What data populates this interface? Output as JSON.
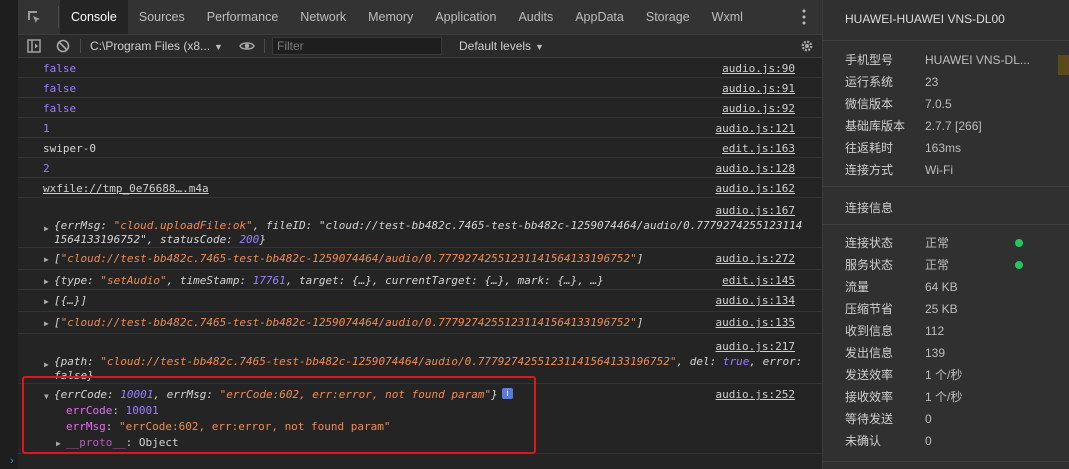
{
  "tabs": [
    {
      "label": "Console",
      "active": true
    },
    {
      "label": "Sources"
    },
    {
      "label": "Performance"
    },
    {
      "label": "Network"
    },
    {
      "label": "Memory"
    },
    {
      "label": "Application"
    },
    {
      "label": "Audits"
    },
    {
      "label": "AppData"
    },
    {
      "label": "Storage"
    },
    {
      "label": "Wxml"
    }
  ],
  "toolbar": {
    "context_label": "C:\\Program Files (x8...",
    "filter_placeholder": "Filter",
    "levels_label": "Default levels",
    "icons": [
      "inspect-icon",
      "sidebar-toggle-icon",
      "clear-console-icon",
      "eye-icon",
      "gear-icon",
      "more-vert-icon"
    ]
  },
  "console": {
    "lines": [
      {
        "text": "false",
        "type": "bool",
        "source": "audio.js:90"
      },
      {
        "text": "false",
        "type": "bool",
        "source": "audio.js:91"
      },
      {
        "text": "false",
        "type": "bool",
        "source": "audio.js:92"
      },
      {
        "text": "1",
        "type": "num",
        "source": "audio.js:121"
      },
      {
        "text": "swiper-0",
        "type": "plain",
        "source": "edit.js:163"
      },
      {
        "text": "2",
        "type": "num",
        "source": "audio.js:128"
      },
      {
        "text": "wxfile://tmp_0e76688….m4a",
        "type": "link",
        "source": "audio.js:162"
      },
      {
        "line1": "{errMsg: \"cloud.uploadFile:ok\", fileID: \"cloud://test-bb482c.7465-test-bb482c-1259074464/audio/0.7779274255123114",
        "line2": "1564133196752\", statusCode: 200}",
        "source": "audio.js:167"
      },
      {
        "text": "[\"cloud://test-bb482c.7465-test-bb482c-1259074464/audio/0.77792742551231141564133196752\"]",
        "source": "audio.js:272"
      },
      {
        "text": "{type: \"setAudio\", timeStamp: 17761, target: {…}, currentTarget: {…}, mark: {…}, …}",
        "source": "edit.js:145"
      },
      {
        "text": "[{…}]",
        "source": "audio.js:134"
      },
      {
        "text": "[\"cloud://test-bb482c.7465-test-bb482c-1259074464/audio/0.77792742551231141564133196752\"]",
        "source": "audio.js:135"
      },
      {
        "line1": "{path: \"cloud://test-bb482c.7465-test-bb482c-1259074464/audio/0.77792742551231141564133196752\", del: true, error:",
        "line2": "false}",
        "source": "audio.js:217"
      }
    ],
    "expanded": {
      "summary": "{errCode: 10001, errMsg: \"errCode:602, err:error, not found param\"}",
      "source": "audio.js:252",
      "props": [
        {
          "key": "errCode",
          "value": "10001",
          "kind": "num"
        },
        {
          "key": "errMsg",
          "value": "\"errCode:602, err:error, not found param\"",
          "kind": "str"
        }
      ],
      "proto_key": "__proto__",
      "proto_value": "Object"
    },
    "prompt": "›"
  },
  "panel": {
    "device": "HUAWEI-HUAWEI VNS-DL00",
    "info": [
      {
        "k": "手机型号",
        "v": "HUAWEI VNS-DL..."
      },
      {
        "k": "运行系统",
        "v": "23"
      },
      {
        "k": "微信版本",
        "v": "7.0.5"
      },
      {
        "k": "基础库版本",
        "v": "2.7.7 [266]"
      },
      {
        "k": "往返耗时",
        "v": "163ms"
      },
      {
        "k": "连接方式",
        "v": "Wi-Fi"
      }
    ],
    "section_title": "连接信息",
    "conn": [
      {
        "k": "连接状态",
        "v": "正常",
        "dot": true
      },
      {
        "k": "服务状态",
        "v": "正常",
        "dot": true
      },
      {
        "k": "流量",
        "v": "64 KB"
      },
      {
        "k": "压缩节省",
        "v": "25 KB"
      },
      {
        "k": "收到信息",
        "v": "112"
      },
      {
        "k": "发出信息",
        "v": "139"
      },
      {
        "k": "发送效率",
        "v": "1 个/秒"
      },
      {
        "k": "接收效率",
        "v": "1 个/秒"
      },
      {
        "k": "等待发送",
        "v": "0"
      },
      {
        "k": "未确认",
        "v": "0"
      }
    ],
    "status_color": "#22c55e"
  }
}
